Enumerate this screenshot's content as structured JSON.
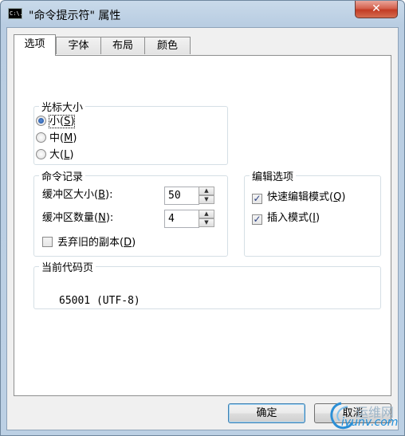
{
  "window": {
    "title": "\"命令提示符\" 属性",
    "close_glyph": "✕",
    "icon_text": "C:\\."
  },
  "tabs": [
    {
      "label": "选项"
    },
    {
      "label": "字体"
    },
    {
      "label": "布局"
    },
    {
      "label": "颜色"
    }
  ],
  "cursor_size": {
    "legend": "光标大小",
    "options": [
      {
        "label": "小",
        "key": "S"
      },
      {
        "label": "中",
        "key": "M"
      },
      {
        "label": "大",
        "key": "L"
      }
    ],
    "selected": "小"
  },
  "command_history": {
    "legend": "命令记录",
    "buffer_size_label": "缓冲区大小",
    "buffer_size_key": "B",
    "buffer_size_value": "50",
    "buffer_count_label": "缓冲区数量",
    "buffer_count_key": "N",
    "buffer_count_value": "4",
    "discard_label": "丢弃旧的副本",
    "discard_key": "D",
    "discard_checked": false
  },
  "edit_options": {
    "legend": "编辑选项",
    "quick_edit_label": "快速编辑模式",
    "quick_edit_key": "Q",
    "quick_edit_checked": true,
    "insert_label": "插入模式",
    "insert_key": "I",
    "insert_checked": true
  },
  "codepage": {
    "legend": "当前代码页",
    "value": "65001 (UTF-8)"
  },
  "buttons": {
    "ok": "确定",
    "cancel": "取消"
  },
  "watermark": {
    "top": "运维网",
    "bottom": "iyunv.com"
  },
  "colors": {
    "title_gradient_top": "#c9daea",
    "close_red": "#c23c25",
    "focus_blue": "#3c7fb1"
  }
}
